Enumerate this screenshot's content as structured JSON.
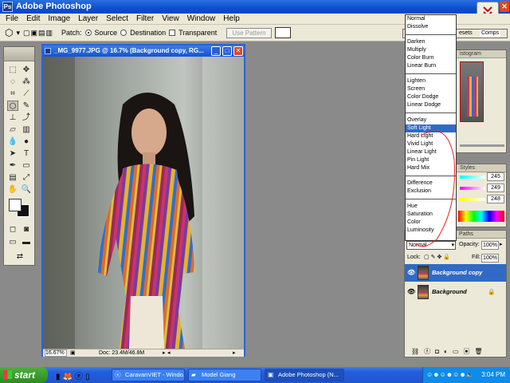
{
  "app": {
    "title": "Adobe Photoshop",
    "icon": "ps-icon"
  },
  "menu": [
    "File",
    "Edit",
    "Image",
    "Layer",
    "Select",
    "Filter",
    "View",
    "Window",
    "Help"
  ],
  "options": {
    "patch_label": "Patch:",
    "source_label": "Source",
    "destination_label": "Destination",
    "transparent_label": "Transparent",
    "use_pattern_label": "Use Pattern",
    "selected": "Source"
  },
  "document": {
    "title": "_MG_9977.JPG @ 16.7% (Background copy, RG...",
    "zoom": "16.67%",
    "doc_size": "Doc: 23.4M/46.8M"
  },
  "palette_tabs": {
    "presets": "esets",
    "comps": "Comps",
    "histogram": "istogram",
    "styles": "Styles",
    "paths": "Paths"
  },
  "color_values": [
    "245",
    "249",
    "248"
  ],
  "blend_modes": {
    "groups": [
      [
        "Normal",
        "Dissolve"
      ],
      [
        "Darken",
        "Multiply",
        "Color Burn",
        "Linear Burn"
      ],
      [
        "Lighten",
        "Screen",
        "Color Dodge",
        "Linear Dodge"
      ],
      [
        "Overlay",
        "Soft Light",
        "Hard Light",
        "Vivid Light",
        "Linear Light",
        "Pin Light",
        "Hard Mix"
      ],
      [
        "Difference",
        "Exclusion"
      ],
      [
        "Hue",
        "Saturation",
        "Color",
        "Luminosity"
      ]
    ],
    "highlighted": "Soft Light"
  },
  "layers": {
    "blend_mode": "Normal",
    "opacity_label": "Opacity:",
    "opacity": "100%",
    "lock_label": "Lock:",
    "fill_label": "Fill:",
    "fill": "100%",
    "items": [
      {
        "name": "Background copy",
        "selected": true
      },
      {
        "name": "Background",
        "selected": false
      }
    ]
  },
  "taskbar": {
    "start": "start",
    "tasks": [
      "CaravanVIET - Windo...",
      "Model Giang",
      "Adobe Photoshop (N..."
    ],
    "clock": "3:04 PM"
  },
  "colors": {
    "accent": "#316ac5",
    "titlebar": "#0c4fd0",
    "chrome": "#ece9d8"
  }
}
